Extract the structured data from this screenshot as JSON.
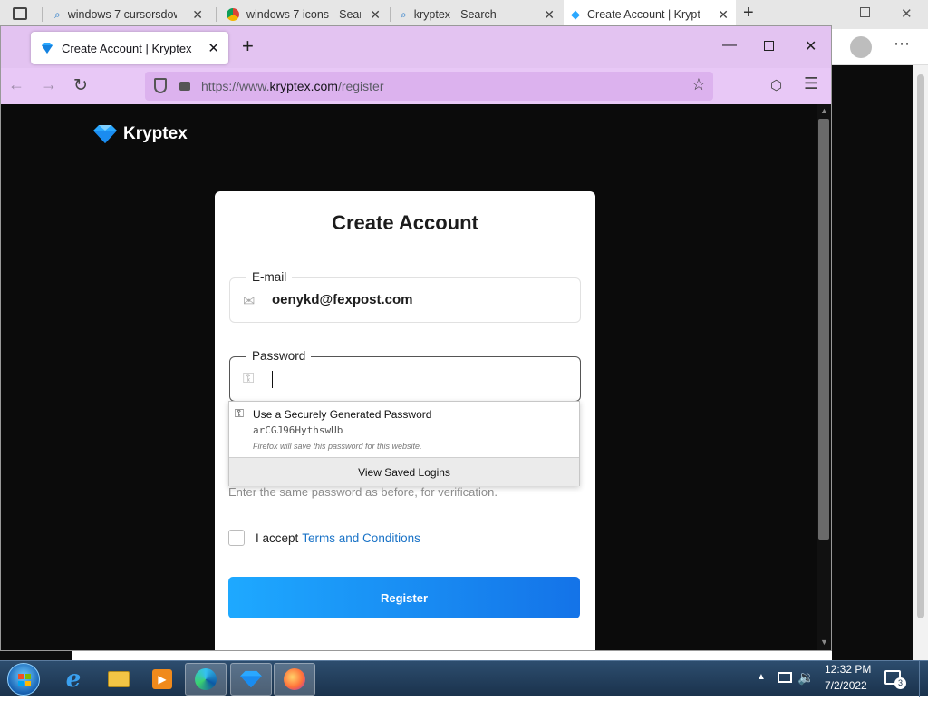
{
  "edge": {
    "tabs": [
      {
        "label": "windows 7 cursorsdown"
      },
      {
        "label": "windows 7 icons - Searc"
      },
      {
        "label": "kryptex - Search"
      },
      {
        "label": "Create Account | Krypte"
      }
    ]
  },
  "firefox": {
    "tab_label": "Create Account | Kryptex",
    "url_prefix": "https://www.",
    "url_host": "kryptex.com",
    "url_path": "/register"
  },
  "page": {
    "logo_text": "Kryptex",
    "title": "Create Account",
    "email": {
      "label": "E-mail",
      "value": "oenykd@fexpost.com"
    },
    "password": {
      "label": "Password",
      "value": ""
    },
    "autocomplete": {
      "title": "Use a Securely Generated Password",
      "generated": "arCGJ96HythswUb",
      "note": "Firefox will save this password for this website.",
      "view_saved": "View Saved Logins"
    },
    "verify_help": "Enter the same password as before, for verification.",
    "terms_prefix": "I accept",
    "terms_link": "Terms and Conditions",
    "register_label": "Register"
  },
  "taskbar": {
    "time": "12:32 PM",
    "date": "7/2/2022",
    "notification_count": "3"
  },
  "colors": {
    "firefox_theme": "#e3c3f1",
    "register_gradient_start": "#1ea9ff",
    "register_gradient_end": "#1473e8",
    "link": "#1a73c7"
  }
}
